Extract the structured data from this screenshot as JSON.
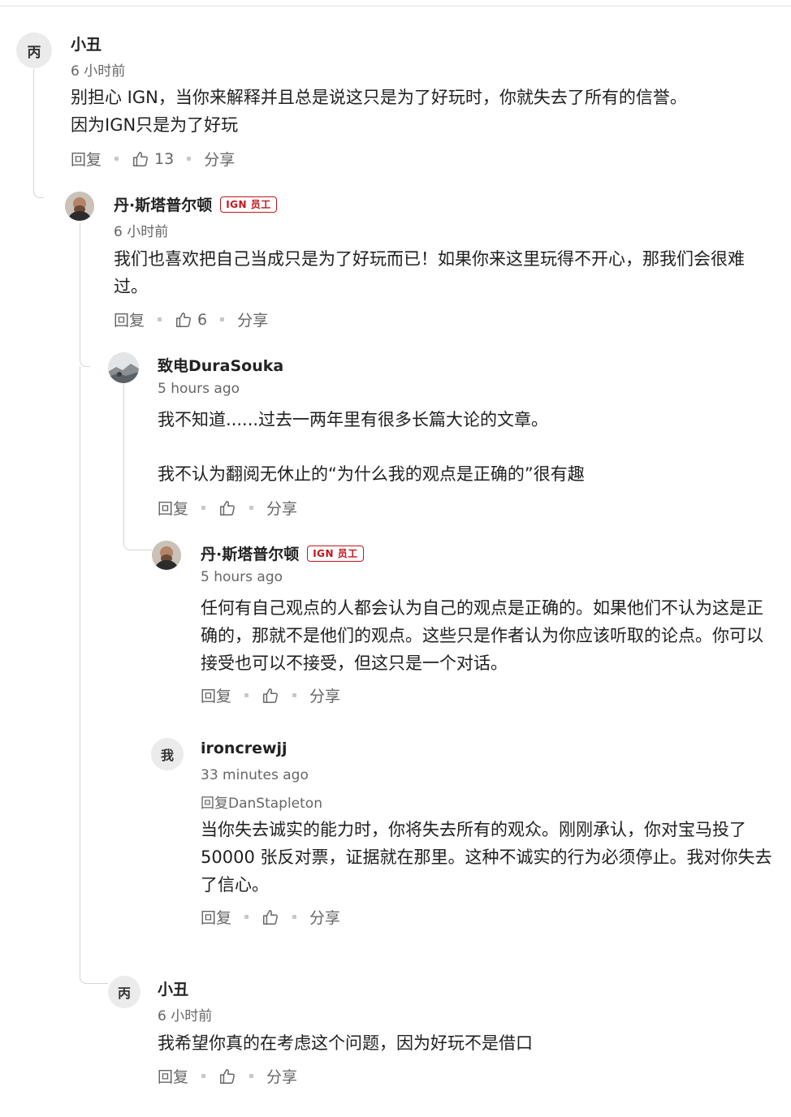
{
  "actions": {
    "reply": "回复",
    "share": "分享"
  },
  "badge": "IGN 员工",
  "comments": {
    "c1": {
      "avatar_letter": "丙",
      "author": "小丑",
      "time": "6 小时前",
      "body": [
        "别担心 IGN，当你来解释并且总是说这只是为了好玩时，你就失去了所有的信誉。",
        "因为IGN只是为了好玩"
      ],
      "likes": "13"
    },
    "c2": {
      "author": "丹·斯塔普尔顿",
      "time": "6 小时前",
      "body": "我们也喜欢把自己当成只是为了好玩而已！如果你来这里玩得不开心，那我们会很难过。",
      "likes": "6"
    },
    "c3": {
      "author": "致电DuraSouka",
      "time": "5 hours ago",
      "body_p1": "我不知道......过去一两年里有很多长篇大论的文章。",
      "body_p2": "我不认为翻阅无休止的“为什么我的观点是正确的”很有趣"
    },
    "c4": {
      "author": "丹·斯塔普尔顿",
      "time": "5 hours ago",
      "body": "任何有自己观点的人都会认为自己的观点是正确的。如果他们不认为这是正确的，那就不是他们的观点。这些只是作者认为你应该听取的论点。你可以接受也可以不接受，但这只是一个对话。"
    },
    "c5": {
      "avatar_letter": "我",
      "author": "ironcrewjj",
      "time": "33 minutes ago",
      "reply_to": "回复DanStapleton",
      "body": "当你失去诚实的能力时，你将失去所有的观众。刚刚承认，你对宝马投了 50000 张反对票，证据就在那里。这种不诚实的行为必须停止。我对你失去了信心。"
    },
    "c6": {
      "avatar_letter": "丙",
      "author": "小丑",
      "time": "6 小时前",
      "body": "我希望你真的在考虑这个问题，因为好玩不是借口"
    }
  },
  "icons": {
    "like": "thumbs-up-icon"
  },
  "colors": {
    "badge": "#c4151c",
    "muted": "#666666",
    "avatar_bg": "#ebebeb"
  }
}
